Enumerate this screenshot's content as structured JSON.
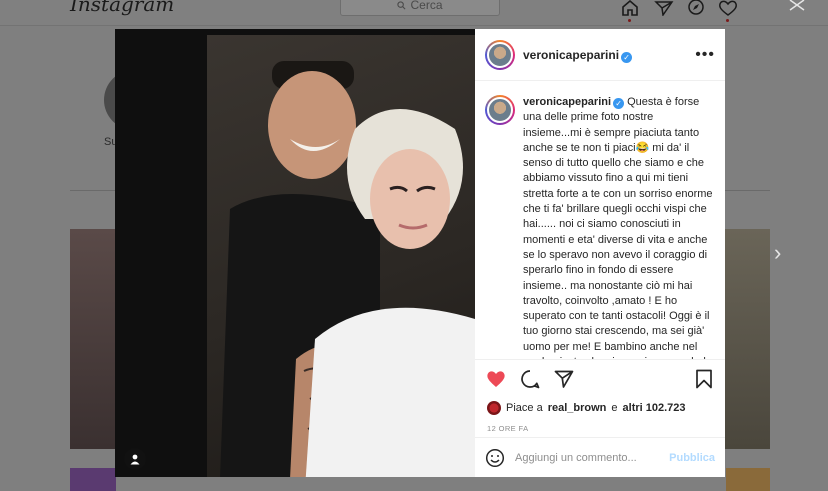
{
  "background": {
    "logo": "Instagram",
    "search_placeholder": "Cerca",
    "profile_label": "Su",
    "nav_icons": [
      "home-icon",
      "explore-direct-icon",
      "compass-icon",
      "heart-icon"
    ]
  },
  "post": {
    "username": "veronicapeparini",
    "verified": true,
    "caption": "Questa è forse una delle prime foto nostre insieme...mi è sempre piaciuta tanto anche se te non ti piaci😂 mi da' il senso di tutto quello che siamo e che abbiamo vissuto fino a qui mi tieni stretta forte a te con un sorriso enorme che ti fa' brillare quegli occhi vispi che hai...... noi ci siamo conosciuti in momenti e eta' diverse di vita e anche se lo speravo non avevo il coraggio di sperarlo fino in fondo di essere insieme.. ma nonostante ciò mi hai travolto, coinvolto ,amato ! E ho superato con te tanti ostacoli! Oggi è il tuo giorno stai crescendo, ma sei già' uomo per me! E bambino anche nel modo giusto che sia..anzi non perderlo mai quel bambino!!! mio Augurio è che tu possa realizzare tutti i tuoi sogni i tuoi obiettivi so'quanto ci tieni e quanto puoi farcela!!!",
    "likes_prefix": "Piace a",
    "likes_user": "real_brown",
    "likes_connector": "e",
    "likes_others": "altri 102.723",
    "timestamp": "12 ORE FA",
    "comment_placeholder": "Aggiungi un commento...",
    "publish_label": "Pubblica",
    "like_color": "#ed4956",
    "accent_color": "#3897f0"
  }
}
